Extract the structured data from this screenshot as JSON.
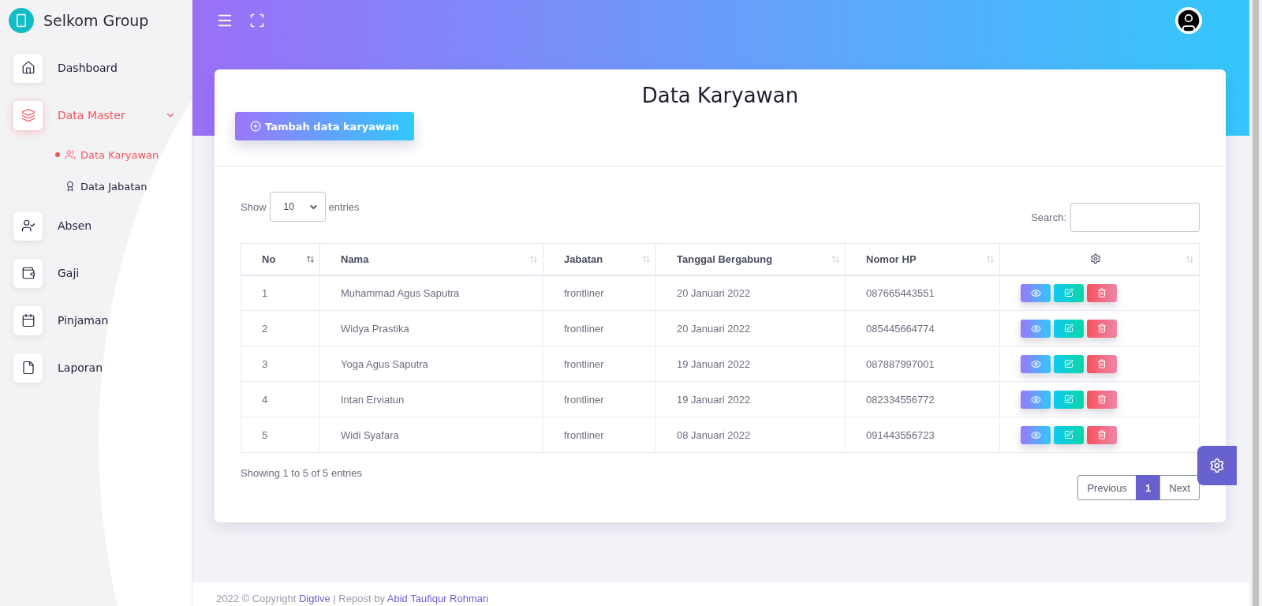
{
  "brand": {
    "name": "Selkom Group"
  },
  "sidebar": {
    "items": [
      {
        "label": "Dashboard",
        "selected": false
      },
      {
        "label": "Data Master",
        "selected": true,
        "expanded": true,
        "children": [
          {
            "label": "Data Karyawan",
            "selected": true
          },
          {
            "label": "Data Jabatan",
            "selected": false
          }
        ]
      },
      {
        "label": "Absen",
        "selected": false
      },
      {
        "label": "Gaji",
        "selected": false
      },
      {
        "label": "Pinjaman",
        "selected": false
      },
      {
        "label": "Laporan",
        "selected": false
      }
    ]
  },
  "card": {
    "title": "Data Karyawan",
    "add_button": "Tambah data karyawan"
  },
  "length_menu": {
    "prefix": "Show",
    "value": "10",
    "suffix": "entries"
  },
  "search": {
    "label": "Search:"
  },
  "table": {
    "columns": [
      {
        "label": "No",
        "sorted": true
      },
      {
        "label": "Nama",
        "sorted": false
      },
      {
        "label": "Jabatan",
        "sorted": false
      },
      {
        "label": "Tanggal Bergabung",
        "sorted": false
      },
      {
        "label": "Nomor HP",
        "sorted": false
      },
      {
        "sorted": false
      }
    ],
    "rows": [
      [
        "1",
        "Muhammad Agus Saputra",
        "frontliner",
        "20 Januari 2022",
        "087665443551"
      ],
      [
        "2",
        "Widya Prastika",
        "frontliner",
        "20 Januari 2022",
        "085445664774"
      ],
      [
        "3",
        "Yoga Agus Saputra",
        "frontliner",
        "19 Januari 2022",
        "087887997001"
      ],
      [
        "4",
        "Intan Erviatun",
        "frontliner",
        "19 Januari 2022",
        "082334556772"
      ],
      [
        "5",
        "Widi Syafara",
        "frontliner",
        "08 Januari 2022",
        "091443556723"
      ]
    ]
  },
  "info": "Showing 1 to 5 of 5 entries",
  "pagination": [
    {
      "label": "Previous",
      "selected": false
    },
    {
      "label": "1",
      "selected": true
    },
    {
      "label": "Next",
      "selected": false
    }
  ],
  "footer": {
    "prefix": "2022 © Copyright",
    "link_1": "Digtive",
    "middle": "| Repost by",
    "link_2": "Abid Taufiqur Rohman"
  }
}
